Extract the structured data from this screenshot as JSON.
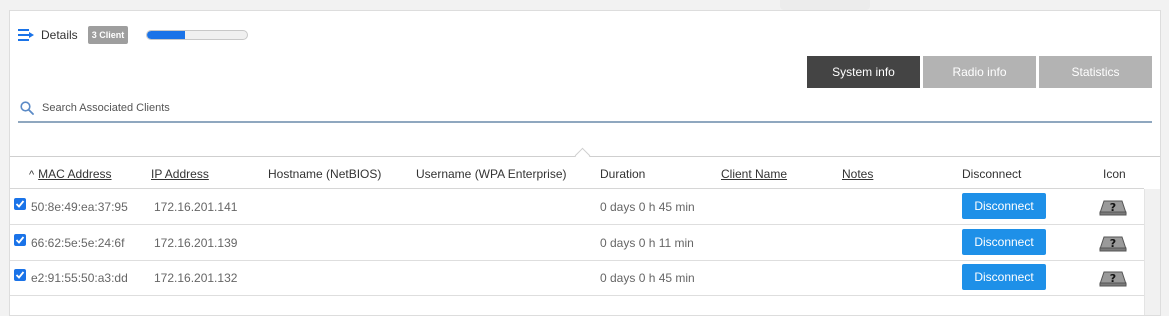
{
  "header": {
    "title": "Details",
    "client_badge": "3 Client",
    "progress_fraction": 0.38
  },
  "tabs": [
    {
      "label": "System info",
      "active": true
    },
    {
      "label": "Radio info",
      "active": false
    },
    {
      "label": "Statistics",
      "active": false
    }
  ],
  "search": {
    "placeholder": "Search Associated Clients",
    "value": ""
  },
  "table": {
    "sort_indicator": "^",
    "columns": {
      "mac": "MAC Address",
      "ip": "IP Address",
      "hostname": "Hostname (NetBIOS)",
      "username": "Username (WPA Enterprise)",
      "duration": "Duration",
      "client_name": "Client Name",
      "notes": "Notes",
      "disconnect": "Disconnect",
      "icon": "Icon"
    },
    "rows": [
      {
        "checked": true,
        "mac": "50:8e:49:ea:37:95",
        "ip": "172.16.201.141",
        "hostname": "",
        "username": "",
        "duration": "0 days 0 h 45 min",
        "client_name": "",
        "notes": "",
        "disconnect_label": "Disconnect",
        "icon": "unknown-device-icon"
      },
      {
        "checked": true,
        "mac": "66:62:5e:5e:24:6f",
        "ip": "172.16.201.139",
        "hostname": "",
        "username": "",
        "duration": "0 days 0 h 11 min",
        "client_name": "",
        "notes": "",
        "disconnect_label": "Disconnect",
        "icon": "unknown-device-icon"
      },
      {
        "checked": true,
        "mac": "e2:91:55:50:a3:dd",
        "ip": "172.16.201.132",
        "hostname": "",
        "username": "",
        "duration": "0 days 0 h 45 min",
        "client_name": "",
        "notes": "",
        "disconnect_label": "Disconnect",
        "icon": "unknown-device-icon"
      }
    ]
  },
  "colors": {
    "accent": "#1e90e8",
    "tab_active": "#444444",
    "tab_inactive": "#b3b3b3",
    "badge": "#9e9e9e"
  }
}
